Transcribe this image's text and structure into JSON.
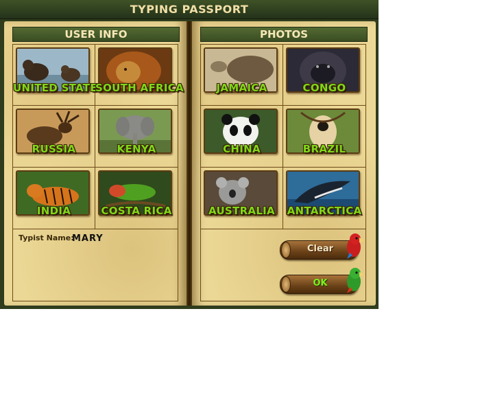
{
  "window": {
    "title": "TYPING PASSPORT"
  },
  "user_info": {
    "header": "USER INFO",
    "countries": [
      {
        "name": "UNITED STATES",
        "icon": "bear-photo"
      },
      {
        "name": "SOUTH AFRICA",
        "icon": "lion-photo"
      },
      {
        "name": "RUSSIA",
        "icon": "elk-photo"
      },
      {
        "name": "KENYA",
        "icon": "elephant-photo"
      },
      {
        "name": "INDIA",
        "icon": "tiger-photo"
      },
      {
        "name": "COSTA RICA",
        "icon": "chameleon-photo"
      }
    ],
    "typist_label": "Typist Name:",
    "typist_name": "MARY"
  },
  "photos": {
    "header": "PHOTOS",
    "countries": [
      {
        "name": "JAMAICA",
        "icon": "tortoise-photo"
      },
      {
        "name": "CONGO",
        "icon": "gorilla-photo"
      },
      {
        "name": "CHINA",
        "icon": "panda-photo"
      },
      {
        "name": "BRAZIL",
        "icon": "gibbon-photo"
      },
      {
        "name": "AUSTRALIA",
        "icon": "koala-photo"
      },
      {
        "name": "ANTARCTICA",
        "icon": "whale-photo"
      }
    ]
  },
  "buttons": {
    "clear": "Clear",
    "ok": "OK"
  },
  "colors": {
    "label_green": "#7fd818",
    "page": "#ecd896",
    "header": "#445a28"
  }
}
